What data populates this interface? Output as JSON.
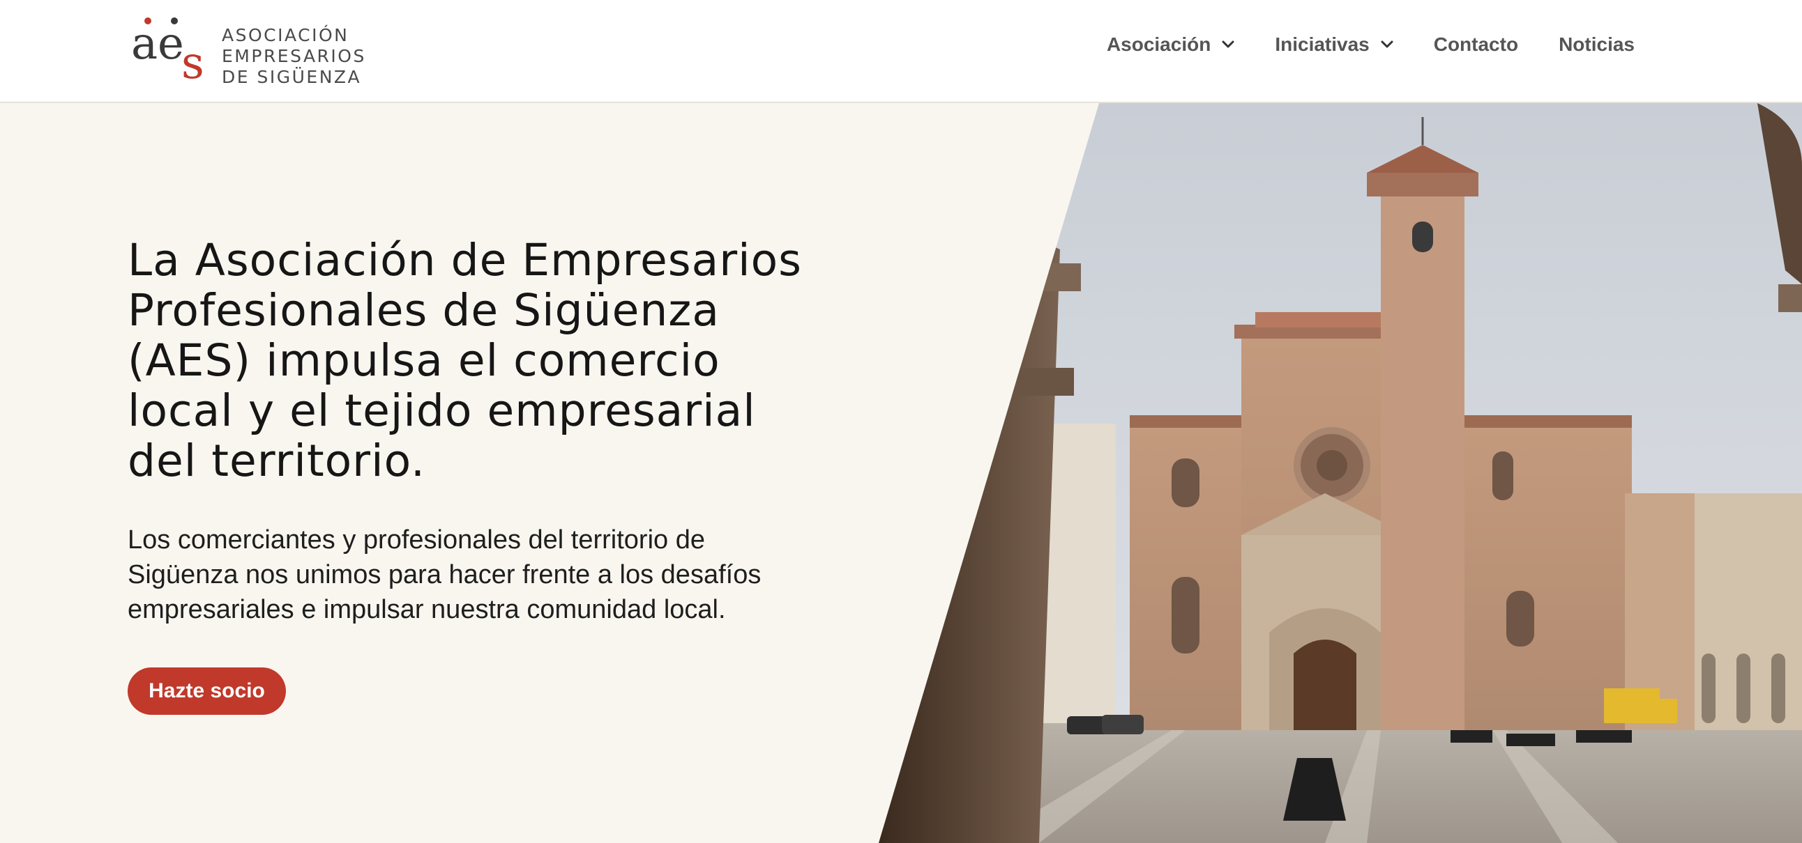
{
  "logo": {
    "mark_letters": "aes",
    "line1": "ASOCIACIÓN",
    "line2": "EMPRESARIOS",
    "line3": "DE SIGÜENZA"
  },
  "nav": {
    "items": [
      {
        "label": "Asociación",
        "has_dropdown": true
      },
      {
        "label": "Iniciativas",
        "has_dropdown": true
      },
      {
        "label": "Contacto",
        "has_dropdown": false
      },
      {
        "label": "Noticias",
        "has_dropdown": false
      }
    ]
  },
  "hero": {
    "title": "La Asociación de Empresarios Profesionales de Sigüenza (AES) impulsa el comercio local y el tejido empresarial del territorio.",
    "subtitle": "Los comerciantes y profesionales del territorio de Sigüenza nos unimos para hacer frente a los desafíos empresariales e impulsar nuestra comunidad local.",
    "cta_label": "Hazte socio",
    "image_subject": "cathedral-plaza-photo"
  },
  "colors": {
    "accent": "#c0392b",
    "background": "#f9f6ef",
    "header_bg": "#ffffff",
    "nav_text": "#555555",
    "title_text": "#161616"
  }
}
